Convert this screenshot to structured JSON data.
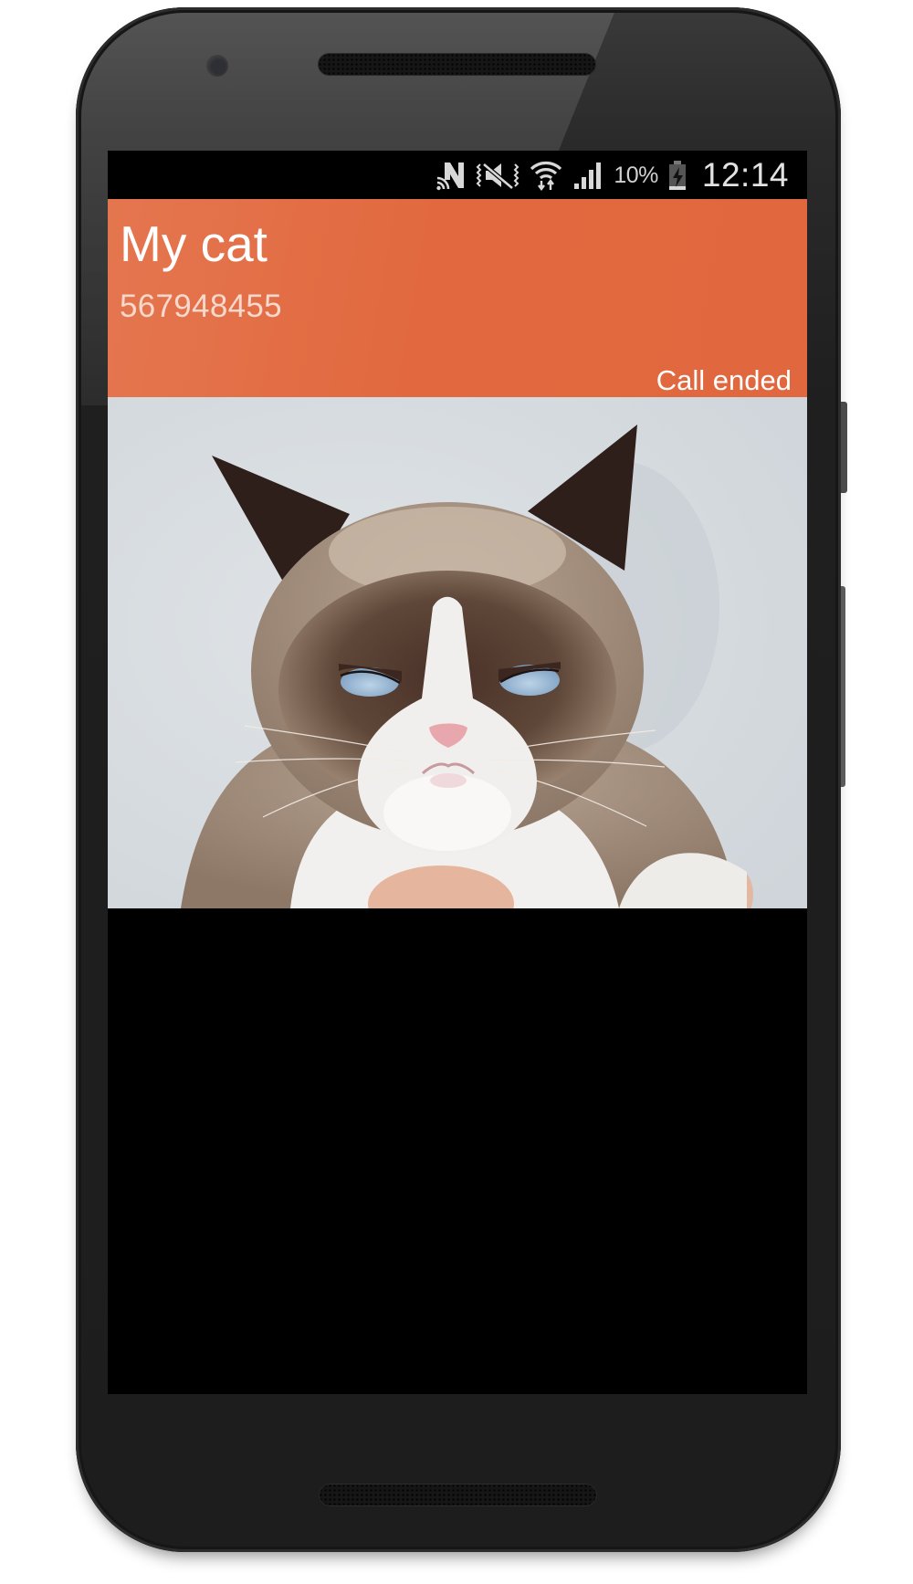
{
  "device": {
    "model": "android-phone",
    "side_buttons": [
      "power",
      "volume"
    ]
  },
  "status_bar": {
    "icons": [
      "nfc-icon",
      "vibrate-mute-icon",
      "wifi-data-icon",
      "cell-signal-icon",
      "battery-charging-icon"
    ],
    "battery_percent": "10%",
    "time": "12:14"
  },
  "call": {
    "contact_name": "My cat",
    "phone_number": "567948455",
    "status": "Call ended",
    "photo": "grumpy-cat-contact-photo",
    "accent_color": "#E2693F"
  },
  "colors": {
    "header": "#E2693F",
    "photo_background": "#D8DDE1",
    "screen_background": "#000000",
    "bezel": "#1F1F1F"
  }
}
